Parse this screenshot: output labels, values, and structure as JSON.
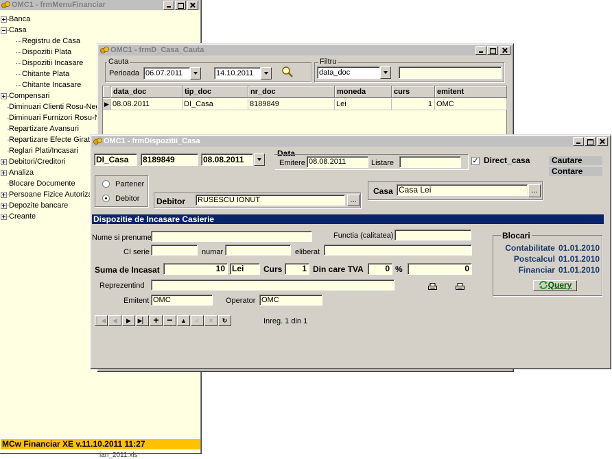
{
  "menu_window": {
    "title": "OMC1 - frmMenuFinanciar",
    "tree": [
      {
        "label": "Banca",
        "level": 0,
        "expander": "plus"
      },
      {
        "label": "Casa",
        "level": 0,
        "expander": "minus"
      },
      {
        "label": "Registru de Casa",
        "level": 1,
        "expander": ""
      },
      {
        "label": "Dispozitii Plata",
        "level": 1,
        "expander": ""
      },
      {
        "label": "Dispozitii Incasare",
        "level": 1,
        "expander": ""
      },
      {
        "label": "Chitante Plata",
        "level": 1,
        "expander": ""
      },
      {
        "label": "Chitante Incasare",
        "level": 1,
        "expander": ""
      },
      {
        "label": "Compensari",
        "level": 0,
        "expander": "plus"
      },
      {
        "label": "Diminuari Clienti Rosu-Negru",
        "level": 0,
        "expander": ""
      },
      {
        "label": "Diminuari Furnizori Rosu-Negru",
        "level": 0,
        "expander": ""
      },
      {
        "label": "Repartizare Avansuri",
        "level": 0,
        "expander": ""
      },
      {
        "label": "Repartizare Efecte Girate",
        "level": 0,
        "expander": ""
      },
      {
        "label": "Reglari Plati/Incasari",
        "level": 0,
        "expander": ""
      },
      {
        "label": "Debitori/Creditori",
        "level": 0,
        "expander": "plus"
      },
      {
        "label": "Analiza",
        "level": 0,
        "expander": "plus"
      },
      {
        "label": "Blocare Documente",
        "level": 0,
        "expander": ""
      },
      {
        "label": "Persoane Fizice Autorizate",
        "level": 0,
        "expander": "plus"
      },
      {
        "label": "Depozite bancare",
        "level": 0,
        "expander": "plus"
      },
      {
        "label": "Creante",
        "level": 0,
        "expander": "plus"
      }
    ],
    "status": "MCw Financiar XE  v.11.10.2011 11:27",
    "below_status": "ian_2011.xls"
  },
  "search_window": {
    "title": "OMC1 - frmD_Casa_Cauta",
    "cauta_group": "Cauta",
    "perioada_label": "Perioada",
    "date_from": "06.07.2011",
    "date_to": "14.10.2011",
    "filtru_group": "Filtru",
    "filtru_field": "data_doc",
    "filtru_value": "",
    "columns": [
      "data_doc",
      "tip_doc",
      "nr_doc",
      "moneda",
      "curs",
      "emitent"
    ],
    "rows": [
      {
        "data_doc": "08.08.2011",
        "tip_doc": "DI_Casa",
        "nr_doc": "8189849",
        "moneda": "Lei",
        "curs": "1",
        "emitent": "OMC"
      }
    ]
  },
  "disp_window": {
    "title": "OMC1 - frmDispozitii_Casa",
    "tip_doc": "DI_Casa",
    "nr_doc": "8189849",
    "data_doc": "08.08.2011",
    "data_group": "Data",
    "emitere_label": "Emitere",
    "emitere_value": "08.08.2011",
    "listare_label": "Listare",
    "listare_value": "",
    "direct_casa_label": "Direct_casa",
    "cautare_label": "Cautare",
    "contare_label": "Contare",
    "radio_partener": "Partener",
    "radio_debitor": "Debitor",
    "debitor_label": "Debitor",
    "debitor_value": "RUSESCU IONUT",
    "casa_label": "Casa",
    "casa_value": "Casa Lei",
    "ellipsis": "...",
    "section_title": "Dispozitie de Incasare Casierie",
    "nume_label": "Nume si prenume",
    "nume_value": "",
    "functia_label": "Functia (calitatea)",
    "functia_value": "",
    "ci_serie_label": "CI serie",
    "ci_serie_value": "",
    "numar_label": "numar",
    "numar_value": "",
    "eliberat_label": "eliberat",
    "eliberat_value": "",
    "suma_label": "Suma de Incasat",
    "suma_value": "10",
    "moneda_value": "Lei",
    "curs_label": "Curs",
    "curs_value": "1",
    "tva_label": "Din care TVA",
    "tva_value": "0",
    "percent": "%",
    "tva_amount": "0",
    "reprezentind_label": "Reprezentind",
    "reprezentind_value": "",
    "emitent_label": "Emitent",
    "emitent_value": "OMC",
    "operator_label": "Operator",
    "operator_value": "OMC",
    "blocari_group": "Blocari",
    "blocari": [
      {
        "label": "Contabilitate",
        "date": "01.01.2010"
      },
      {
        "label": "Postcalcul",
        "date": "01.01.2010"
      },
      {
        "label": "Financiar",
        "date": "01.01.2010"
      }
    ],
    "query_label": "Query",
    "record_info": "Inreg. 1 din 1"
  },
  "colors": {
    "field_bg": "#ffffe1",
    "section_bar": "#0a246a",
    "status_bar": "#ffc000"
  }
}
